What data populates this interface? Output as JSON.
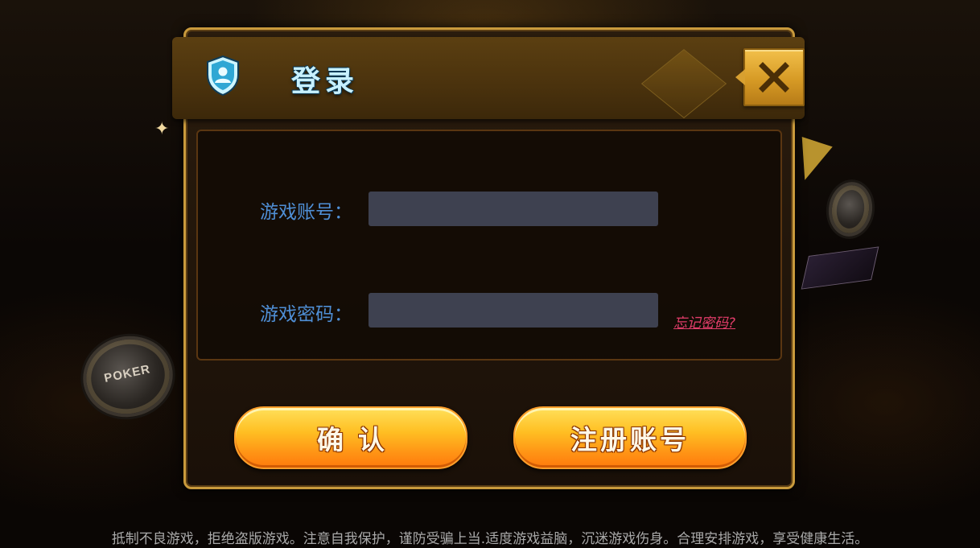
{
  "dialog": {
    "title": "登录",
    "close_icon": "close-icon",
    "header_icon": "shield-user-icon"
  },
  "form": {
    "account_label": "游戏账号：",
    "account_value": "",
    "password_label": "游戏密码：",
    "password_value": "",
    "forgot_password": "忘记密码?"
  },
  "buttons": {
    "confirm": "确认",
    "register": "注册账号"
  },
  "footer": {
    "notice": "抵制不良游戏，拒绝盗版游戏。注意自我保护，谨防受骗上当.适度游戏益脑，沉迷游戏伤身。合理安排游戏，享受健康生活。"
  },
  "background": {
    "poker_chip_text": "POKER"
  },
  "colors": {
    "label_blue": "#4f8fd6",
    "link_pink": "#e23d6a",
    "gold_border": "#c99a3c",
    "button_orange": "#ffa51d"
  }
}
